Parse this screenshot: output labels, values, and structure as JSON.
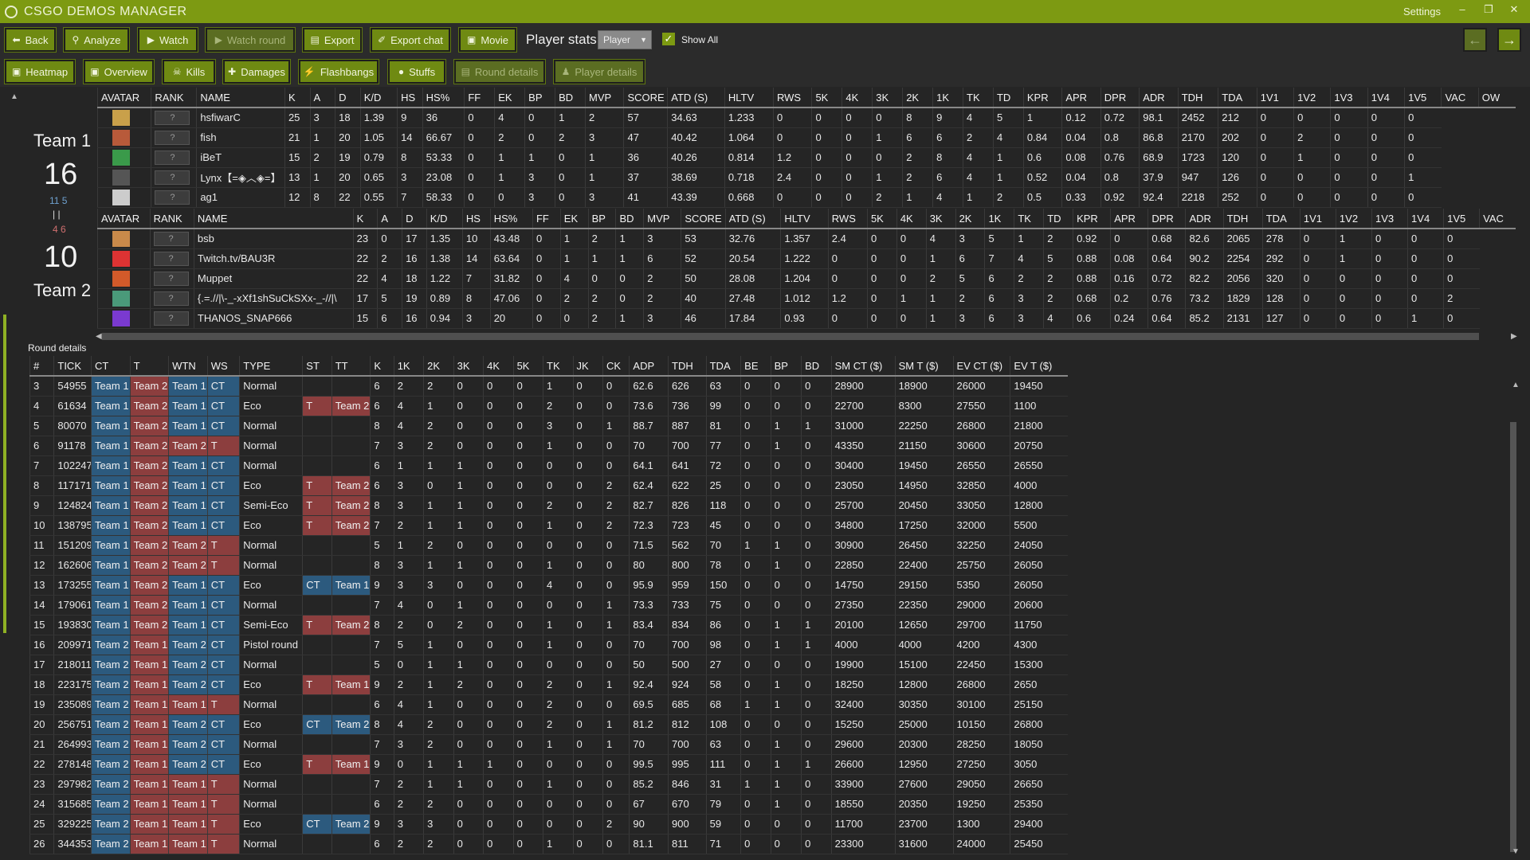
{
  "app": {
    "title": "CSGO DEMOS MANAGER",
    "settings": "Settings"
  },
  "toolbar": {
    "buttons": [
      {
        "label": "Back"
      },
      {
        "label": "Analyze"
      },
      {
        "label": "Watch"
      },
      {
        "label": "Watch round"
      },
      {
        "label": "Export"
      },
      {
        "label": "Export chat"
      },
      {
        "label": "Movie"
      }
    ],
    "player_stats_label": "Player stats",
    "player_select": "Player",
    "show_all": "Show All"
  },
  "tabs": [
    {
      "label": "Heatmap"
    },
    {
      "label": "Overview"
    },
    {
      "label": "Kills"
    },
    {
      "label": "Damages"
    },
    {
      "label": "Flashbangs"
    },
    {
      "label": "Stuffs"
    },
    {
      "label": "Round details"
    },
    {
      "label": "Player details"
    }
  ],
  "teams": {
    "team1": {
      "name": "Team 1",
      "score": "16"
    },
    "team2": {
      "name": "Team 2",
      "score": "10"
    },
    "half1": "11 5",
    "half2": "4 6"
  },
  "rank_placeholder": "?",
  "player_headers": [
    "AVATAR",
    "RANK",
    "NAME",
    "K",
    "A",
    "D",
    "K/D",
    "HS",
    "HS%",
    "FF",
    "EK",
    "BP",
    "BD",
    "MVP",
    "SCORE",
    "ATD (S)",
    "HLTV",
    "RWS",
    "5K",
    "4K",
    "3K",
    "2K",
    "1K",
    "TK",
    "TD",
    "KPR",
    "APR",
    "DPR",
    "ADR",
    "TDH",
    "TDA",
    "1V1",
    "1V2",
    "1V3",
    "1V4",
    "1V5",
    "VAC",
    "OW"
  ],
  "team1_players": [
    [
      "hsfiwarC",
      "25",
      "3",
      "18",
      "1.39",
      "9",
      "36",
      "0",
      "4",
      "0",
      "1",
      "2",
      "57",
      "34.63",
      "1.233",
      "0",
      "0",
      "0",
      "0",
      "8",
      "9",
      "4",
      "5",
      "1",
      "0.12",
      "0.72",
      "98.1",
      "2452",
      "212",
      "0",
      "0",
      "0",
      "0",
      "0"
    ],
    [
      "fish",
      "21",
      "1",
      "20",
      "1.05",
      "14",
      "66.67",
      "0",
      "2",
      "0",
      "2",
      "3",
      "47",
      "40.42",
      "1.064",
      "0",
      "0",
      "0",
      "1",
      "6",
      "6",
      "2",
      "4",
      "0.84",
      "0.04",
      "0.8",
      "86.8",
      "2170",
      "202",
      "0",
      "2",
      "0",
      "0",
      "0"
    ],
    [
      "iBeT",
      "15",
      "2",
      "19",
      "0.79",
      "8",
      "53.33",
      "0",
      "1",
      "1",
      "0",
      "1",
      "36",
      "40.26",
      "0.814",
      "1.2",
      "0",
      "0",
      "0",
      "2",
      "8",
      "4",
      "1",
      "0.6",
      "0.08",
      "0.76",
      "68.9",
      "1723",
      "120",
      "0",
      "1",
      "0",
      "0",
      "0"
    ],
    [
      "Lynx【=◈︿◈=】",
      "13",
      "1",
      "20",
      "0.65",
      "3",
      "23.08",
      "0",
      "1",
      "3",
      "0",
      "1",
      "37",
      "38.69",
      "0.718",
      "2.4",
      "0",
      "0",
      "1",
      "2",
      "6",
      "4",
      "1",
      "0.52",
      "0.04",
      "0.8",
      "37.9",
      "947",
      "126",
      "0",
      "0",
      "0",
      "0",
      "1"
    ],
    [
      "ag1",
      "12",
      "8",
      "22",
      "0.55",
      "7",
      "58.33",
      "0",
      "0",
      "3",
      "0",
      "3",
      "41",
      "43.39",
      "0.668",
      "0",
      "0",
      "0",
      "2",
      "1",
      "4",
      "1",
      "2",
      "0.5",
      "0.33",
      "0.92",
      "92.4",
      "2218",
      "252",
      "0",
      "0",
      "0",
      "0",
      "0"
    ]
  ],
  "team2_players": [
    [
      "bsb",
      "23",
      "0",
      "17",
      "1.35",
      "10",
      "43.48",
      "0",
      "1",
      "2",
      "1",
      "3",
      "53",
      "32.76",
      "1.357",
      "2.4",
      "0",
      "0",
      "4",
      "3",
      "5",
      "1",
      "2",
      "0.92",
      "0",
      "0.68",
      "82.6",
      "2065",
      "278",
      "0",
      "1",
      "0",
      "0",
      "0"
    ],
    [
      "Twitch.tv/BAU3R",
      "22",
      "2",
      "16",
      "1.38",
      "14",
      "63.64",
      "0",
      "1",
      "1",
      "1",
      "6",
      "52",
      "20.54",
      "1.222",
      "0",
      "0",
      "0",
      "1",
      "6",
      "7",
      "4",
      "5",
      "0.88",
      "0.08",
      "0.64",
      "90.2",
      "2254",
      "292",
      "0",
      "1",
      "0",
      "0",
      "0"
    ],
    [
      "Muppet",
      "22",
      "4",
      "18",
      "1.22",
      "7",
      "31.82",
      "0",
      "4",
      "0",
      "0",
      "2",
      "50",
      "28.08",
      "1.204",
      "0",
      "0",
      "0",
      "2",
      "5",
      "6",
      "2",
      "2",
      "0.88",
      "0.16",
      "0.72",
      "82.2",
      "2056",
      "320",
      "0",
      "0",
      "0",
      "0",
      "0"
    ],
    [
      "{.=.//|\\-_-xXf1shSuCkSXx-_-//|\\",
      "17",
      "5",
      "19",
      "0.89",
      "8",
      "47.06",
      "0",
      "2",
      "2",
      "0",
      "2",
      "40",
      "27.48",
      "1.012",
      "1.2",
      "0",
      "1",
      "1",
      "2",
      "6",
      "3",
      "2",
      "0.68",
      "0.2",
      "0.76",
      "73.2",
      "1829",
      "128",
      "0",
      "0",
      "0",
      "0",
      "2"
    ],
    [
      "THANOS_SNAP666",
      "15",
      "6",
      "16",
      "0.94",
      "3",
      "20",
      "0",
      "0",
      "2",
      "1",
      "3",
      "46",
      "17.84",
      "0.93",
      "0",
      "0",
      "0",
      "1",
      "3",
      "6",
      "3",
      "4",
      "0.6",
      "0.24",
      "0.64",
      "85.2",
      "2131",
      "127",
      "0",
      "0",
      "0",
      "1",
      "0"
    ]
  ],
  "round_details_label": "Round details",
  "round_headers": [
    "#",
    "TICK",
    "CT",
    "T",
    "WTN",
    "WS",
    "TYPE",
    "ST",
    "TT",
    "K",
    "1K",
    "2K",
    "3K",
    "4K",
    "5K",
    "TK",
    "JK",
    "CK",
    "ADP",
    "TDH",
    "TDA",
    "BE",
    "BP",
    "BD",
    "SM CT ($)",
    "SM T ($)",
    "EV CT ($)",
    "EV T ($)"
  ],
  "rounds": [
    [
      "3",
      "54955",
      "Team 1",
      "Team 2",
      "Team 1",
      "CT",
      "Normal",
      "",
      "",
      "6",
      "2",
      "2",
      "0",
      "0",
      "0",
      "1",
      "0",
      "0",
      "62.6",
      "626",
      "63",
      "0",
      "0",
      "0",
      "28900",
      "18900",
      "26000",
      "19450"
    ],
    [
      "4",
      "61634",
      "Team 1",
      "Team 2",
      "Team 1",
      "CT",
      "Eco",
      "T",
      "Team 2",
      "6",
      "4",
      "1",
      "0",
      "0",
      "0",
      "2",
      "0",
      "0",
      "73.6",
      "736",
      "99",
      "0",
      "0",
      "0",
      "22700",
      "8300",
      "27550",
      "1100"
    ],
    [
      "5",
      "80070",
      "Team 1",
      "Team 2",
      "Team 1",
      "CT",
      "Normal",
      "",
      "",
      "8",
      "4",
      "2",
      "0",
      "0",
      "0",
      "3",
      "0",
      "1",
      "88.7",
      "887",
      "81",
      "0",
      "1",
      "1",
      "31000",
      "22250",
      "26800",
      "21800"
    ],
    [
      "6",
      "91178",
      "Team 1",
      "Team 2",
      "Team 2",
      "T",
      "Normal",
      "",
      "",
      "7",
      "3",
      "2",
      "0",
      "0",
      "0",
      "1",
      "0",
      "0",
      "70",
      "700",
      "77",
      "0",
      "1",
      "0",
      "43350",
      "21150",
      "30600",
      "20750"
    ],
    [
      "7",
      "102247",
      "Team 1",
      "Team 2",
      "Team 1",
      "CT",
      "Normal",
      "",
      "",
      "6",
      "1",
      "1",
      "1",
      "0",
      "0",
      "0",
      "0",
      "0",
      "64.1",
      "641",
      "72",
      "0",
      "0",
      "0",
      "30400",
      "19450",
      "26550",
      "26550"
    ],
    [
      "8",
      "117171",
      "Team 1",
      "Team 2",
      "Team 1",
      "CT",
      "Eco",
      "T",
      "Team 2",
      "6",
      "3",
      "0",
      "1",
      "0",
      "0",
      "0",
      "0",
      "2",
      "62.4",
      "622",
      "25",
      "0",
      "0",
      "0",
      "23050",
      "14950",
      "32850",
      "4000"
    ],
    [
      "9",
      "124824",
      "Team 1",
      "Team 2",
      "Team 1",
      "CT",
      "Semi-Eco",
      "T",
      "Team 2",
      "8",
      "3",
      "1",
      "1",
      "0",
      "0",
      "2",
      "0",
      "2",
      "82.7",
      "826",
      "118",
      "0",
      "0",
      "0",
      "25700",
      "20450",
      "33050",
      "12800"
    ],
    [
      "10",
      "138795",
      "Team 1",
      "Team 2",
      "Team 1",
      "CT",
      "Eco",
      "T",
      "Team 2",
      "7",
      "2",
      "1",
      "1",
      "0",
      "0",
      "1",
      "0",
      "2",
      "72.3",
      "723",
      "45",
      "0",
      "0",
      "0",
      "34800",
      "17250",
      "32000",
      "5500"
    ],
    [
      "11",
      "151209",
      "Team 1",
      "Team 2",
      "Team 2",
      "T",
      "Normal",
      "",
      "",
      "5",
      "1",
      "2",
      "0",
      "0",
      "0",
      "0",
      "0",
      "0",
      "71.5",
      "562",
      "70",
      "1",
      "1",
      "0",
      "30900",
      "26450",
      "32250",
      "24050"
    ],
    [
      "12",
      "162606",
      "Team 1",
      "Team 2",
      "Team 2",
      "T",
      "Normal",
      "",
      "",
      "8",
      "3",
      "1",
      "1",
      "0",
      "0",
      "1",
      "0",
      "0",
      "80",
      "800",
      "78",
      "0",
      "1",
      "0",
      "22850",
      "22400",
      "25750",
      "26050"
    ],
    [
      "13",
      "173255",
      "Team 1",
      "Team 2",
      "Team 1",
      "CT",
      "Eco",
      "CT",
      "Team 1",
      "9",
      "3",
      "3",
      "0",
      "0",
      "0",
      "4",
      "0",
      "0",
      "95.9",
      "959",
      "150",
      "0",
      "0",
      "0",
      "14750",
      "29150",
      "5350",
      "26050"
    ],
    [
      "14",
      "179061",
      "Team 1",
      "Team 2",
      "Team 1",
      "CT",
      "Normal",
      "",
      "",
      "7",
      "4",
      "0",
      "1",
      "0",
      "0",
      "0",
      "0",
      "1",
      "73.3",
      "733",
      "75",
      "0",
      "0",
      "0",
      "27350",
      "22350",
      "29000",
      "20600"
    ],
    [
      "15",
      "193830",
      "Team 1",
      "Team 2",
      "Team 1",
      "CT",
      "Semi-Eco",
      "T",
      "Team 2",
      "8",
      "2",
      "0",
      "2",
      "0",
      "0",
      "1",
      "0",
      "1",
      "83.4",
      "834",
      "86",
      "0",
      "1",
      "1",
      "20100",
      "12650",
      "29700",
      "11750"
    ],
    [
      "16",
      "209971",
      "Team 2",
      "Team 1",
      "Team 2",
      "CT",
      "Pistol round",
      "",
      "",
      "7",
      "5",
      "1",
      "0",
      "0",
      "0",
      "1",
      "0",
      "0",
      "70",
      "700",
      "98",
      "0",
      "1",
      "1",
      "4000",
      "4000",
      "4200",
      "4300"
    ],
    [
      "17",
      "218011",
      "Team 2",
      "Team 1",
      "Team 2",
      "CT",
      "Normal",
      "",
      "",
      "5",
      "0",
      "1",
      "1",
      "0",
      "0",
      "0",
      "0",
      "0",
      "50",
      "500",
      "27",
      "0",
      "0",
      "0",
      "19900",
      "15100",
      "22450",
      "15300"
    ],
    [
      "18",
      "223175",
      "Team 2",
      "Team 1",
      "Team 2",
      "CT",
      "Eco",
      "T",
      "Team 1",
      "9",
      "2",
      "1",
      "2",
      "0",
      "0",
      "2",
      "0",
      "1",
      "92.4",
      "924",
      "58",
      "0",
      "1",
      "0",
      "18250",
      "12800",
      "26800",
      "2650"
    ],
    [
      "19",
      "235089",
      "Team 2",
      "Team 1",
      "Team 1",
      "T",
      "Normal",
      "",
      "",
      "6",
      "4",
      "1",
      "0",
      "0",
      "0",
      "2",
      "0",
      "0",
      "69.5",
      "685",
      "68",
      "1",
      "1",
      "0",
      "32400",
      "30350",
      "30100",
      "25150"
    ],
    [
      "20",
      "256751",
      "Team 2",
      "Team 1",
      "Team 2",
      "CT",
      "Eco",
      "CT",
      "Team 2",
      "8",
      "4",
      "2",
      "0",
      "0",
      "0",
      "2",
      "0",
      "1",
      "81.2",
      "812",
      "108",
      "0",
      "0",
      "0",
      "15250",
      "25000",
      "10150",
      "26800"
    ],
    [
      "21",
      "264993",
      "Team 2",
      "Team 1",
      "Team 2",
      "CT",
      "Normal",
      "",
      "",
      "7",
      "3",
      "2",
      "0",
      "0",
      "0",
      "1",
      "0",
      "1",
      "70",
      "700",
      "63",
      "0",
      "1",
      "0",
      "29600",
      "20300",
      "28250",
      "18050"
    ],
    [
      "22",
      "278148",
      "Team 2",
      "Team 1",
      "Team 2",
      "CT",
      "Eco",
      "T",
      "Team 1",
      "9",
      "0",
      "1",
      "1",
      "1",
      "0",
      "0",
      "0",
      "0",
      "99.5",
      "995",
      "111",
      "0",
      "1",
      "1",
      "26600",
      "12950",
      "27250",
      "3050"
    ],
    [
      "23",
      "297982",
      "Team 2",
      "Team 1",
      "Team 1",
      "T",
      "Normal",
      "",
      "",
      "7",
      "2",
      "1",
      "1",
      "0",
      "0",
      "1",
      "0",
      "0",
      "85.2",
      "846",
      "31",
      "1",
      "1",
      "0",
      "33900",
      "27600",
      "29050",
      "26650"
    ],
    [
      "24",
      "315685",
      "Team 2",
      "Team 1",
      "Team 1",
      "T",
      "Normal",
      "",
      "",
      "6",
      "2",
      "2",
      "0",
      "0",
      "0",
      "0",
      "0",
      "0",
      "67",
      "670",
      "79",
      "0",
      "1",
      "0",
      "18550",
      "20350",
      "19250",
      "25350"
    ],
    [
      "25",
      "329225",
      "Team 2",
      "Team 1",
      "Team 1",
      "T",
      "Eco",
      "CT",
      "Team 2",
      "9",
      "3",
      "3",
      "0",
      "0",
      "0",
      "0",
      "0",
      "2",
      "90",
      "900",
      "59",
      "0",
      "0",
      "0",
      "11700",
      "23700",
      "1300",
      "29400"
    ],
    [
      "26",
      "344353",
      "Team 2",
      "Team 1",
      "Team 1",
      "T",
      "Normal",
      "",
      "",
      "6",
      "2",
      "2",
      "0",
      "0",
      "0",
      "1",
      "0",
      "0",
      "81.1",
      "811",
      "71",
      "0",
      "0",
      "0",
      "23300",
      "31600",
      "24000",
      "25450"
    ]
  ],
  "colors": {
    "accent": "#7d9a12",
    "ct": "#2c5a7e",
    "t": "#8c3e3e",
    "background": "#252525"
  },
  "icons": [
    "back-icon",
    "search-icon",
    "play-icon",
    "export-icon",
    "chat-icon",
    "movie-icon",
    "map-icon",
    "kills-icon",
    "damages-icon",
    "flash-icon",
    "grenade-icon",
    "arrow-left-icon",
    "arrow-right-icon"
  ]
}
